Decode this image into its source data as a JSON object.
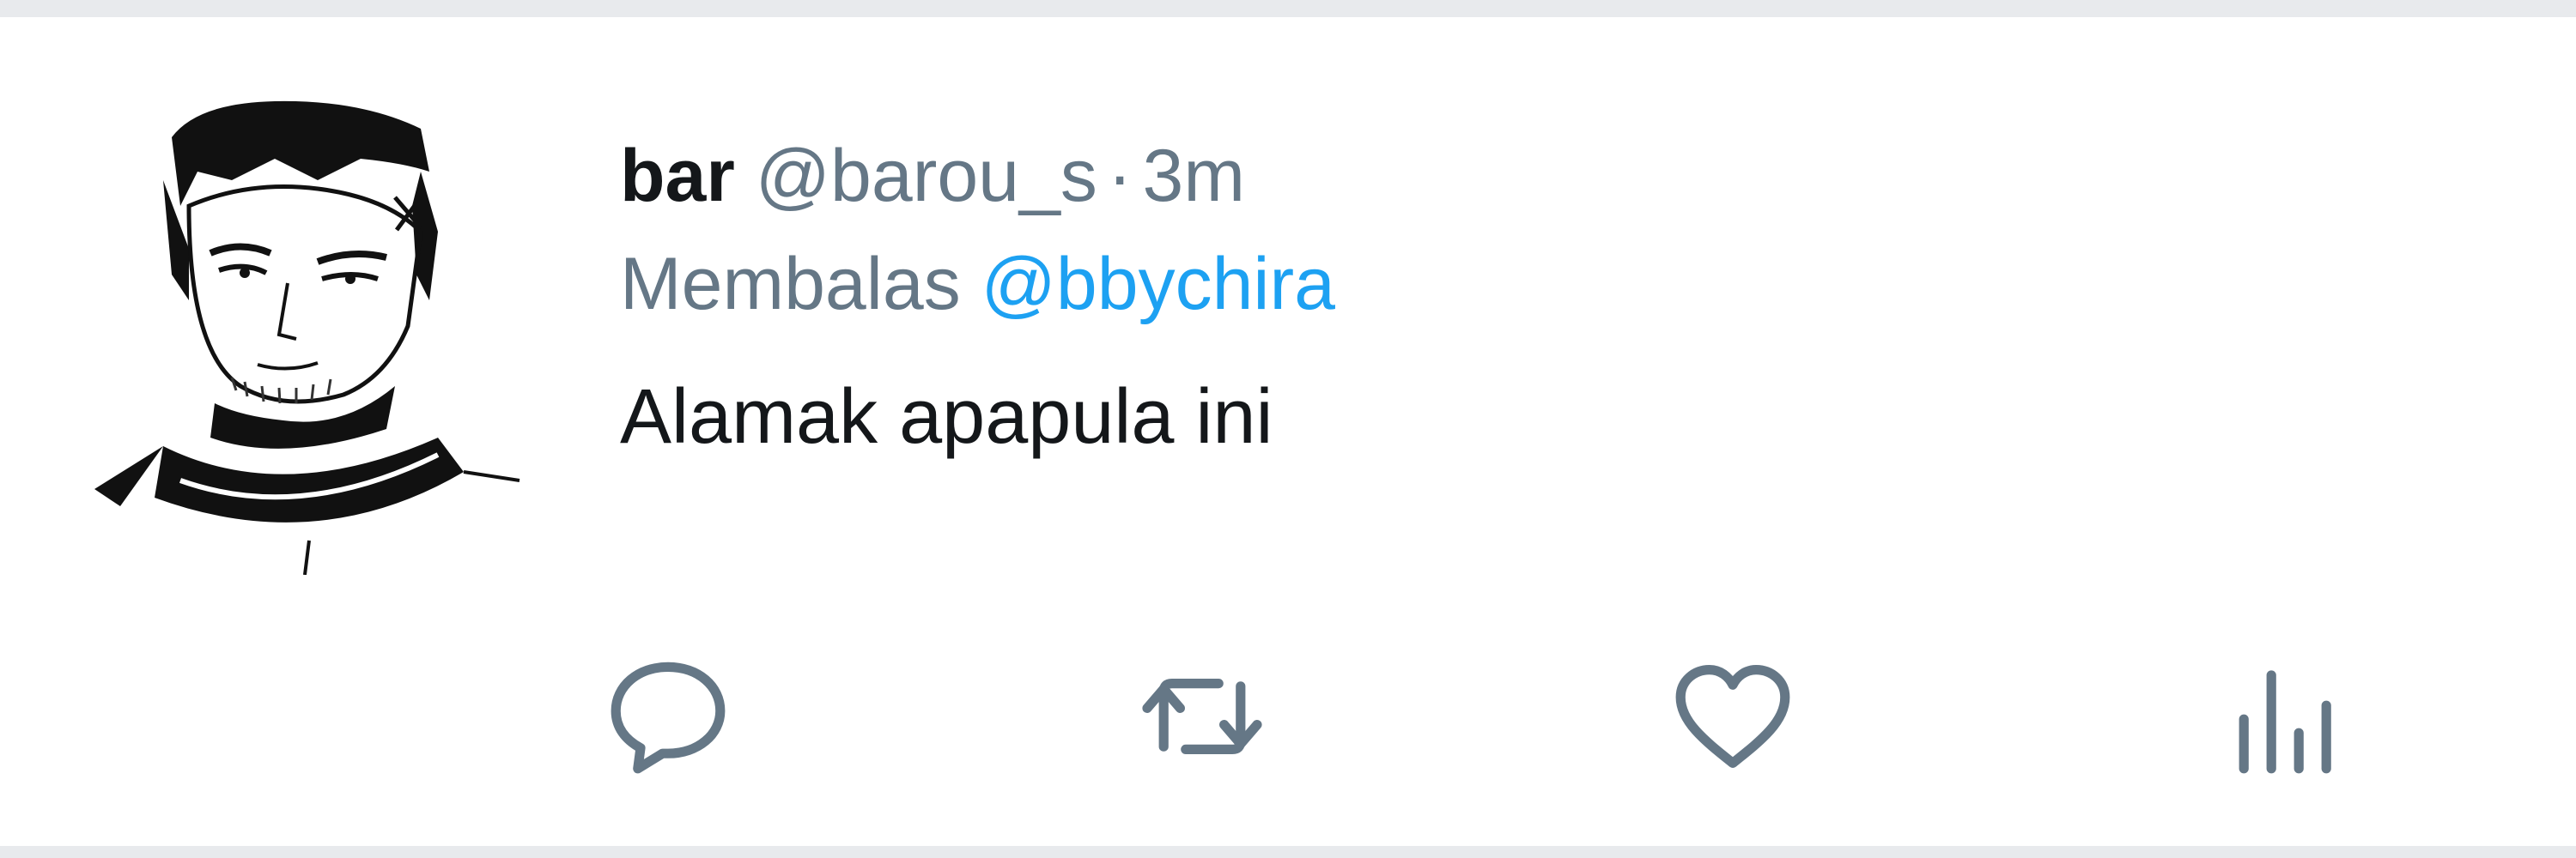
{
  "tweet": {
    "display_name": "bar",
    "handle": "@barou_s",
    "separator": "·",
    "time": "3m",
    "reply_prefix": "Membalas",
    "reply_to": "@bbychira",
    "text": "Alamak apapula ini"
  },
  "actions": [
    {
      "name": "reply",
      "icon": "reply-icon"
    },
    {
      "name": "retweet",
      "icon": "retweet-icon"
    },
    {
      "name": "like",
      "icon": "heart-icon"
    },
    {
      "name": "analytics",
      "icon": "analytics-icon"
    }
  ],
  "colors": {
    "name": "#14171a",
    "secondary": "#657786",
    "link": "#1da1f2",
    "divider": "#e8eaed"
  }
}
